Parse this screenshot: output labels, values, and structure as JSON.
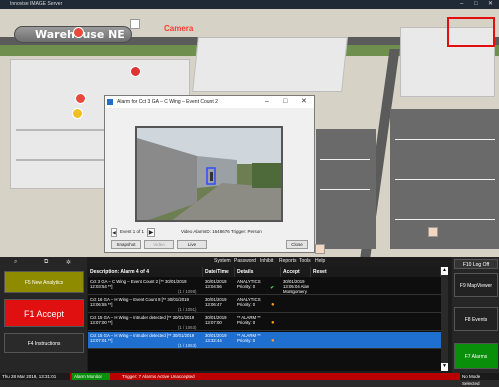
{
  "window": {
    "title": "Innovise IMAGE Server",
    "minimize": "–",
    "maximize": "□",
    "close": "✕"
  },
  "map": {
    "site_label": "Warehouse NE",
    "camera_label": "Camera"
  },
  "popup": {
    "title": "Alarm for Cct 3 GA – C Wing – Event Count 2",
    "minimize": "–",
    "maximize": "□",
    "close": "✕",
    "event_label": "Event 1 of 1",
    "video_info": "Video AlarmID: 1648676 Trigger: Person",
    "buttons": {
      "snapshot": "Snapshot",
      "video": "Video",
      "live": "Live",
      "close": "Close"
    }
  },
  "toolbar": {
    "search_icon": "⌕"
  },
  "left_buttons": {
    "new_analytics": "F5 New Analytics",
    "accept": "F1 Accept",
    "instructions": "F4 Instructions"
  },
  "menu": [
    "System",
    "Password",
    "Inhibit",
    "Reports",
    "Tools",
    "Help"
  ],
  "table": {
    "columns": [
      "Description: Alarm 4 of 4",
      "Date/Time",
      "Details",
      "Accept",
      "Reset"
    ],
    "rows": [
      {
        "desc": "Cct 3 GA – C Wing – Event Count 2 [** 30/01/2019 12:03:54 **]",
        "count": "(1 / 1098)",
        "datetime": "30/01/2019 13:04:56",
        "details": "ANALYTICS Priority: 0",
        "accept": "30/01/2019 13:05:04 Alan Montgomery",
        "selected": false
      },
      {
        "desc": "Cct 16 GA – H Wing – Event Count 8 [** 30/01/2019 13:06:55 **]",
        "count": "(1 / 1091)",
        "datetime": "30/01/2019 13:06:47",
        "details": "ANALYTICS Priority: 0",
        "accept": "",
        "selected": false
      },
      {
        "desc": "Cct 15 GA – H Wing – Intruder detected [** 30/01/2019 13:07:00 **]",
        "count": "(1 / 1063)",
        "datetime": "30/01/2019 13:07:00",
        "details": "** ALARM ** Priority: 0",
        "accept": "",
        "selected": false
      },
      {
        "desc": "Cct 15 GA – H Wing – Intruder detected [** 30/01/2019 13:07:01 **]",
        "count": "(1 / 1063)",
        "datetime": "30/01/2019 13:32:44",
        "details": "** ALARM ** Priority: 0",
        "accept": "",
        "selected": true
      }
    ]
  },
  "right_buttons": {
    "log_off": "F10 Log Off",
    "map_viewer": "F9 MapViewer",
    "events": "F8 Events",
    "alarms": "F7 Alarms"
  },
  "status": {
    "datetime": "Thu 28 Mar 2019, 13:31:01",
    "alarm_monitor": "Alarm Monitor",
    "trigger": "Trigger: 7 Alarms Active Unaccepted",
    "mode": "No Mode Selected"
  },
  "colors": {
    "accept_red": "#e01010",
    "analytics_yellow": "#b8b400",
    "selected_blue": "#1f6fd1",
    "alarms_green": "#0a8f0a",
    "status_red": "#b80000"
  }
}
